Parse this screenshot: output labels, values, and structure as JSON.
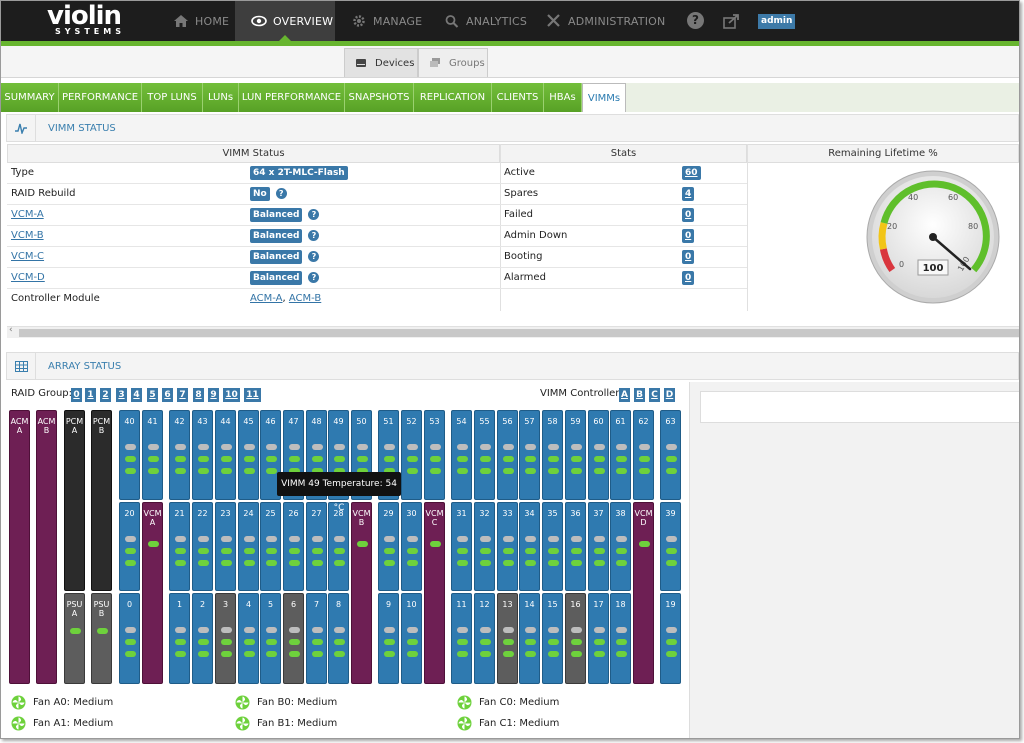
{
  "brand": {
    "name": "violin",
    "sub": "SYSTEMS"
  },
  "nav": {
    "items": [
      {
        "label": "HOME",
        "icon": "home-icon"
      },
      {
        "label": "OVERVIEW",
        "icon": "eye-icon",
        "active": true
      },
      {
        "label": "MANAGE",
        "icon": "gear-icon"
      },
      {
        "label": "ANALYTICS",
        "icon": "search-icon"
      },
      {
        "label": "ADMINISTRATION",
        "icon": "tools-icon"
      }
    ],
    "help_icon": "?",
    "user": "admin"
  },
  "view_switch": {
    "devices": "Devices",
    "groups": "Groups"
  },
  "tabs": [
    "SUMMARY",
    "PERFORMANCE",
    "TOP LUNs",
    "LUNs",
    "LUN PERFORMANCE",
    "SNAPSHOTS",
    "REPLICATION",
    "CLIENTS",
    "HBAs",
    "VIMMs"
  ],
  "vimm_status": {
    "title": "VIMM STATUS",
    "col_status": "VIMM Status",
    "col_stats": "Stats",
    "col_lifetime": "Remaining Lifetime %",
    "rows": [
      {
        "label": "Type",
        "value": "64 x 2T-MLC-Flash",
        "stat": "Active",
        "num": "60"
      },
      {
        "label": "RAID Rebuild",
        "value": "No",
        "stat": "Spares",
        "num": "4"
      },
      {
        "label": "VCM-A",
        "value": "Balanced",
        "stat": "Failed",
        "num": "0"
      },
      {
        "label": "VCM-B",
        "value": "Balanced",
        "stat": "Admin Down",
        "num": "0"
      },
      {
        "label": "VCM-C",
        "value": "Balanced",
        "stat": "Booting",
        "num": "0"
      },
      {
        "label": "VCM-D",
        "value": "Balanced",
        "stat": "Alarmed",
        "num": "0"
      },
      {
        "label": "Controller Module",
        "acm_a": "ACM-A",
        "acm_b": "ACM-B"
      }
    ],
    "gauge": {
      "value": "100",
      "ticks": [
        "0",
        "20",
        "40",
        "60",
        "80",
        "100"
      ]
    }
  },
  "array_status": {
    "title": "ARRAY STATUS",
    "raid_label": "RAID Group:",
    "raid_groups": [
      "0",
      "1",
      "2",
      "3",
      "4",
      "5",
      "6",
      "7",
      "8",
      "9",
      "10",
      "11"
    ],
    "vimm_controller_label": "VIMM Controller:",
    "controllers": [
      "A",
      "B",
      "C",
      "D"
    ],
    "tooltip": "VIMM 49 Temperature: 54 °C",
    "side_modules": [
      {
        "l1": "ACM",
        "l2": "A"
      },
      {
        "l1": "ACM",
        "l2": "B"
      },
      {
        "l1": "PCM",
        "l2": "A"
      },
      {
        "l1": "PCM",
        "l2": "B"
      },
      {
        "l1": "PSU",
        "l2": "A"
      },
      {
        "l1": "PSU",
        "l2": "B"
      }
    ],
    "row1": [
      "40",
      "41",
      "42",
      "43",
      "44",
      "45",
      "46",
      "47",
      "48",
      "49",
      "50",
      "51",
      "52",
      "53",
      "54",
      "55",
      "56",
      "57",
      "58",
      "59",
      "60",
      "61",
      "62",
      "63"
    ],
    "row2": [
      "20",
      "VCM A",
      "21",
      "22",
      "23",
      "24",
      "25",
      "26",
      "27",
      "28",
      "29 ",
      "VCM B",
      "29",
      "30",
      "VCM C",
      "31",
      "32",
      "33",
      "34",
      "35",
      "36",
      "37",
      "38",
      "VCM D",
      "39"
    ],
    "row3": [
      "0",
      "1",
      "2",
      "3",
      "4",
      "5",
      "6",
      "7",
      "8",
      "9",
      "10",
      "11",
      "12",
      "13",
      "14",
      "15",
      "16",
      "17",
      "18",
      "19"
    ],
    "fans": [
      "Fan A0: Medium",
      "Fan B0: Medium",
      "Fan C0: Medium",
      "Fan A1: Medium",
      "Fan B1: Medium",
      "Fan C1: Medium"
    ]
  },
  "colors": {
    "green": "#67b52f",
    "blue": "#2f7ab0",
    "purple": "#6e1f54",
    "dark": "#1d1d1d"
  }
}
